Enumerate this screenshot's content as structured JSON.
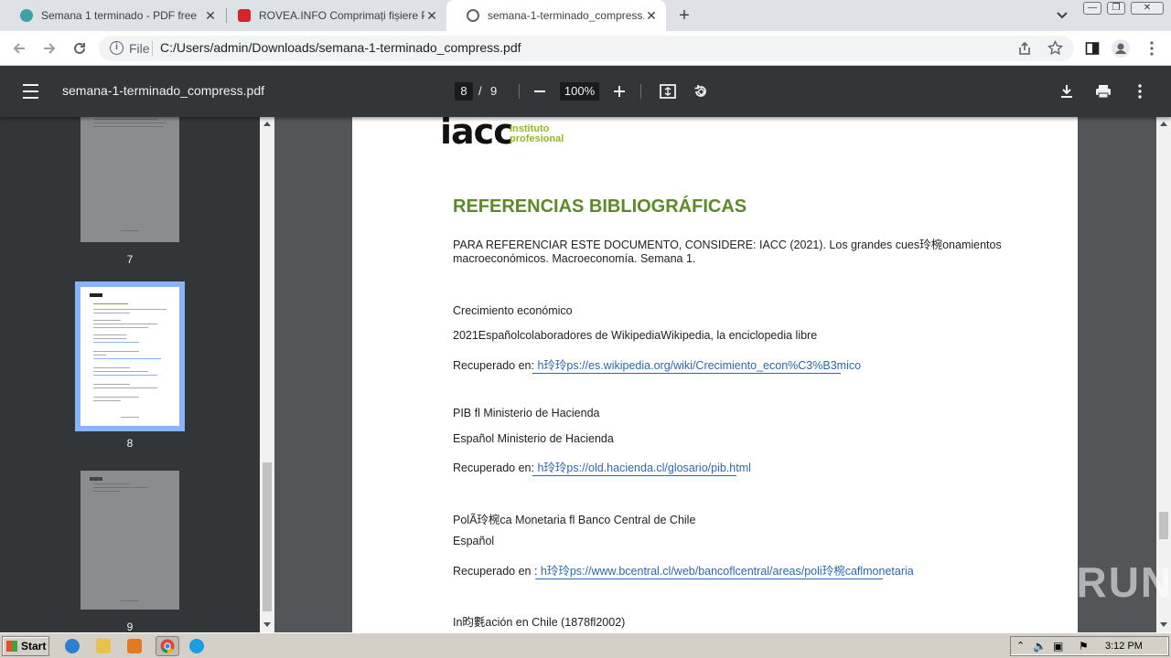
{
  "tabs": [
    {
      "title": "Semana 1 terminado - PDF free",
      "favicon_color": "#3fa1a8"
    },
    {
      "title": "ROVEA.INFO Comprimați fișiere PDF",
      "favicon_color": "#d8232a"
    },
    {
      "title": "semana-1-terminado_compress.pdf",
      "favicon_color": "#5f6368"
    }
  ],
  "newtab_symbol": "+",
  "omnibox": {
    "scheme": "File",
    "url": "C:/Users/admin/Downloads/semana-1-terminado_compress.pdf"
  },
  "pdf_toolbar": {
    "title": "semana-1-terminado_compress.pdf",
    "current_page": "8",
    "separator": "/",
    "total_pages": "9",
    "zoom": "100%"
  },
  "thumbnails": [
    {
      "label": "7"
    },
    {
      "label": "8"
    },
    {
      "label": "9"
    }
  ],
  "document": {
    "logo_main": "iacc",
    "logo_sub_1": "instituto",
    "logo_sub_2": "profesional",
    "heading": "REFERENCIAS BIBLIOGRÁFICAS",
    "intro_1": "PARA REFERENCIAR ESTE DOCUMENTO, CONSIDERE: IACC (2021). Los grandes cues玲椀onamientos",
    "intro_2": "macroeconómicos. Macroeconomía. Semana 1.",
    "ref1_title": "Crecimiento económico",
    "ref1_meta": "2021Españolcolaboradores de WikipediaWikipedia, la enciclopedia libre",
    "ref1_label": "Recuperado en: ",
    "ref1_link": "h玲玲ps://es.wikipedia.org/wiki/Crecimiento_econ%C3%B3mico",
    "ref2_title": "PIB fl Ministerio de Hacienda",
    "ref2_meta": "Español Ministerio de Hacienda",
    "ref2_label": "Recuperado en: ",
    "ref2_link": "h玲玲ps://old.hacienda.cl/glosario/pib.html",
    "ref3_title": "PolÃ玲椀ca Monetaria fl Banco Central de Chile",
    "ref3_meta": "Español",
    "ref3_label": "Recuperado en : ",
    "ref3_link": "h玲玲ps://www.bcentral.cl/web/bancoflcentral/areas/poli玲椀caflmonetaria",
    "ref4_title": "In昀氀ación en Chile (1878fl2002)"
  },
  "watermark": "ANY▷RUN",
  "taskbar": {
    "start_label": "Start",
    "clock": "3:12 PM"
  }
}
